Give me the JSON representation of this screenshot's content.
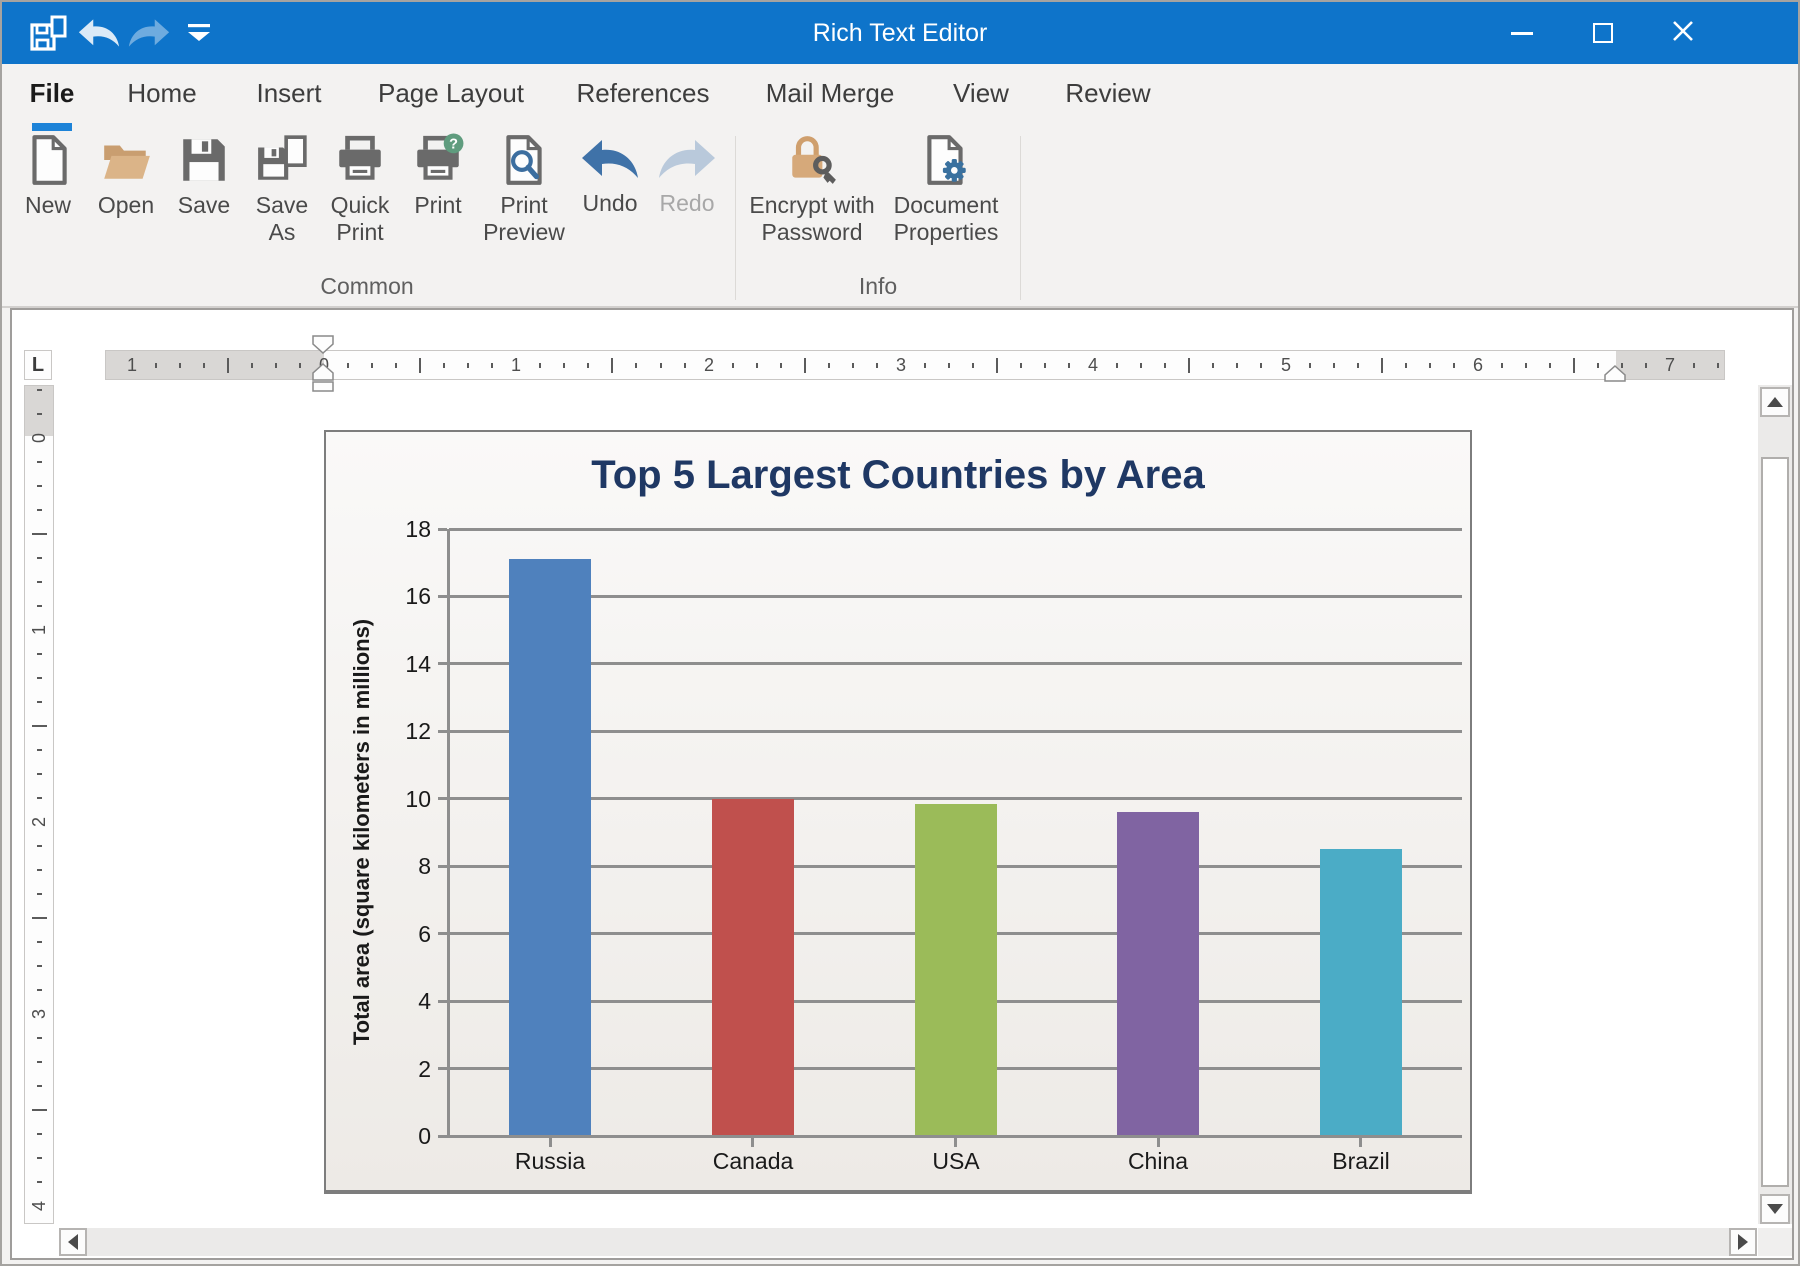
{
  "window": {
    "title": "Rich Text Editor"
  },
  "quick_access_toolbar": {
    "buttons": [
      {
        "name": "qat-save-as",
        "icon": "qat-save-as-icon"
      },
      {
        "name": "qat-undo",
        "icon": "qat-undo-icon"
      },
      {
        "name": "qat-redo",
        "icon": "qat-redo-icon"
      },
      {
        "name": "qat-customize",
        "icon": "qat-chevron-icon"
      }
    ]
  },
  "ribbon": {
    "tabs": [
      {
        "label": "File",
        "active": true
      },
      {
        "label": "Home"
      },
      {
        "label": "Insert"
      },
      {
        "label": "Page Layout"
      },
      {
        "label": "References"
      },
      {
        "label": "Mail Merge"
      },
      {
        "label": "View"
      },
      {
        "label": "Review"
      }
    ],
    "groups": [
      {
        "label": "Common",
        "buttons": [
          {
            "label": "New",
            "icon": "new-document-icon"
          },
          {
            "label": "Open",
            "icon": "open-folder-icon"
          },
          {
            "label": "Save",
            "icon": "save-icon"
          },
          {
            "label": "Save As",
            "icon": "save-as-icon"
          },
          {
            "label": "Quick Print",
            "icon": "quick-print-icon"
          },
          {
            "label": "Print",
            "icon": "print-icon"
          },
          {
            "label": "Print Preview",
            "icon": "print-preview-icon"
          },
          {
            "label": "Undo",
            "icon": "undo-icon"
          },
          {
            "label": "Redo",
            "icon": "redo-icon",
            "disabled": true
          }
        ]
      },
      {
        "label": "Info",
        "buttons": [
          {
            "label": "Encrypt with Password",
            "icon": "encrypt-password-icon"
          },
          {
            "label": "Document Properties",
            "icon": "document-properties-icon"
          }
        ]
      }
    ]
  },
  "rulers": {
    "tab_selector": "L",
    "horizontal_numbers": [
      "1",
      "0",
      "1",
      "2",
      "3",
      "4",
      "5",
      "6",
      "7"
    ],
    "vertical_numbers": [
      "0",
      "1",
      "2",
      "3",
      "4"
    ]
  },
  "chart_data": {
    "type": "bar",
    "title": "Top 5 Largest Countries by Area",
    "title_color": "#1f3864",
    "categories": [
      "Russia",
      "Canada",
      "USA",
      "China",
      "Brazil"
    ],
    "values": [
      17.1,
      10.0,
      9.85,
      9.6,
      8.5
    ],
    "bar_colors": [
      "#4f81bd",
      "#c0504d",
      "#9bbb59",
      "#8064a2",
      "#4bacc6"
    ],
    "xlabel": "",
    "ylabel": "Total area (square kilometers in millions)",
    "ylim": [
      0,
      18
    ],
    "ytick_step": 2,
    "grid": true,
    "legend": "none"
  }
}
